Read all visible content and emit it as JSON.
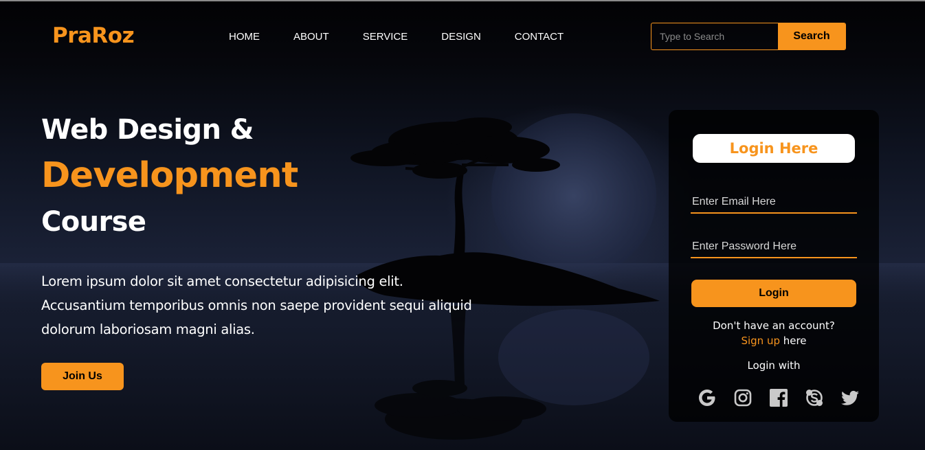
{
  "brand": {
    "logo": "PraRoz",
    "accent": "#f7941d"
  },
  "nav": {
    "items": [
      "HOME",
      "ABOUT",
      "SERVICE",
      "DESIGN",
      "CONTACT"
    ]
  },
  "search": {
    "placeholder": "Type to Search",
    "button": "Search"
  },
  "hero": {
    "line1": "Web Design &",
    "line2": "Development",
    "line3": "Course",
    "paragraph": "Lorem ipsum dolor sit amet consectetur adipisicing elit. Accusantium temporibus omnis non saepe provident sequi aliquid dolorum laboriosam magni alias.",
    "cta": "Join Us"
  },
  "login": {
    "title": "Login Here",
    "email_placeholder": "Enter Email Here",
    "password_placeholder": "Enter Password Here",
    "button": "Login",
    "no_account": "Don't have an account?",
    "signup_link": "Sign up",
    "signup_suffix": " here",
    "login_with": "Login with",
    "socials": [
      "google-icon",
      "instagram-icon",
      "facebook-icon",
      "skype-icon",
      "twitter-icon"
    ]
  }
}
